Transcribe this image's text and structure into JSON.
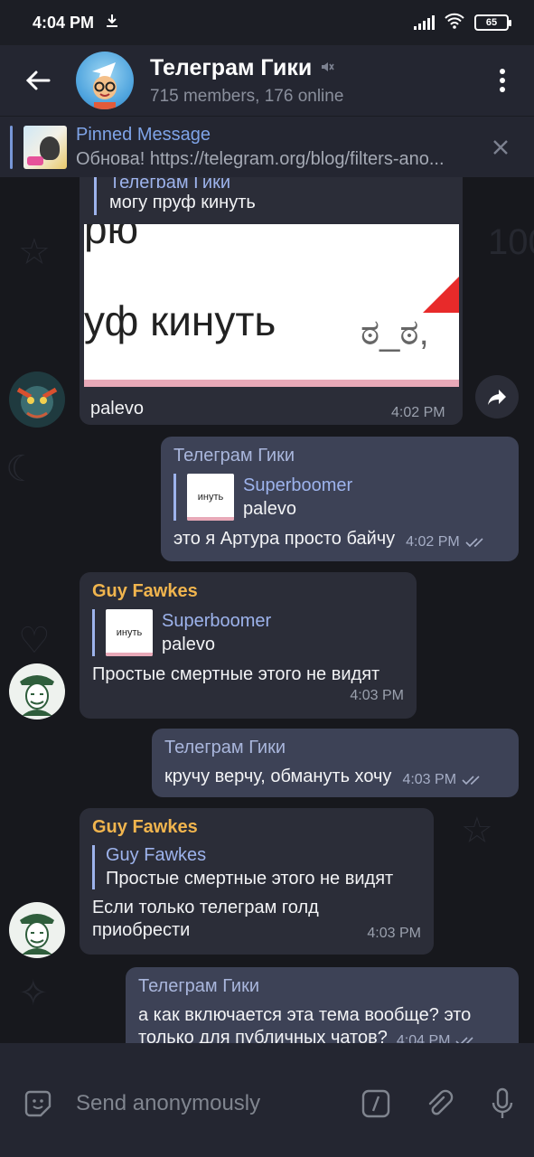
{
  "status_bar": {
    "time": "4:04 PM",
    "download_icon": "download-icon",
    "battery": "65"
  },
  "header": {
    "title": "Телеграм Гики",
    "subtitle": "715 members, 176 online"
  },
  "pinned": {
    "title": "Pinned Message",
    "text": "Обнова! https://telegram.org/blog/filters-ano..."
  },
  "messages": {
    "m1": {
      "caption_prefix": "Телеграм Гики",
      "quote_line": "могу пруф кинуть",
      "image_line1": "рю",
      "image_line2": "уф кинуть",
      "image_face": "ಠ_ಠ,",
      "text": "palevo",
      "time": "4:02 PM"
    },
    "m2": {
      "sender": "Телеграм Гики",
      "reply_name": "Superboomer",
      "reply_text": "palevo",
      "reply_thumb": "инуть",
      "text": "это я Артура просто байчу",
      "time": "4:02 PM"
    },
    "m3": {
      "sender": "Guy Fawkes",
      "reply_name": "Superboomer",
      "reply_text": "palevo",
      "reply_thumb": "инуть",
      "text": "Простые смертные этого не видят",
      "time": "4:03 PM"
    },
    "m4": {
      "sender": "Телеграм Гики",
      "text": "кручу верчу, обмануть хочу",
      "time": "4:03 PM"
    },
    "m5": {
      "sender": "Guy Fawkes",
      "reply_name": "Guy Fawkes",
      "reply_text": "Простые смертные этого не видят",
      "text_line1": "Если только телеграм голд",
      "text_line2": "приобрести",
      "time": "4:03 PM"
    },
    "m6": {
      "sender": "Телеграм Гики",
      "text_line1": "а как включается эта тема вообще? это",
      "text_line2": "только для публичных чатов?",
      "time": "4:04 PM"
    }
  },
  "input": {
    "placeholder": "Send anonymously"
  },
  "colors": {
    "accent_blue": "#7fa4e8",
    "sender_orange": "#f1b54e",
    "bubble_out": "#3d4256",
    "bubble_in": "#2b2d38"
  }
}
